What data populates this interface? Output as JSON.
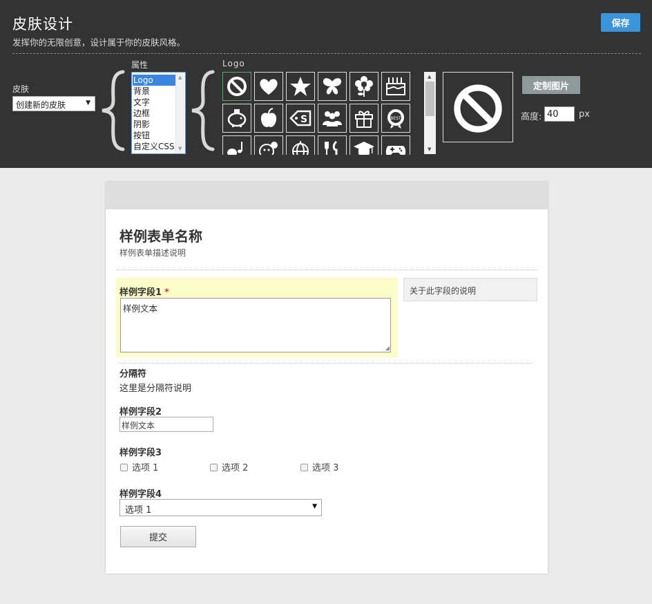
{
  "designer": {
    "title": "皮肤设计",
    "subtitle": "发挥你的无限创意，设计属于你的皮肤风格。",
    "save_label": "保存",
    "skin": {
      "label": "皮肤",
      "selected": "创建新的皮肤"
    },
    "properties": {
      "label": "属性",
      "items": [
        "Logo",
        "背景",
        "文字",
        "边框",
        "阴影",
        "按钮",
        "自定义CSS"
      ],
      "selected": "Logo"
    },
    "logo": {
      "label": "Logo",
      "icons": [
        "ban-icon",
        "heart-icon",
        "star-icon",
        "butterfly-icon",
        "flower-icon",
        "cake-icon",
        "piggy-bank-icon",
        "apple-icon",
        "price-tag-icon",
        "group-icon",
        "gift-icon",
        "best-badge-icon",
        "music-note-icon",
        "chat-face-icon",
        "globe-icon",
        "utensils-icon",
        "graduation-cap-icon",
        "gamepad-icon"
      ],
      "selected_icon": "ban-icon"
    },
    "custom_image_label": "定制图片",
    "height": {
      "label": "高度:",
      "value": "40",
      "unit": "px"
    }
  },
  "form": {
    "title": "样例表单名称",
    "description": "样例表单描述说明",
    "field1": {
      "label": "样例字段1",
      "required_mark": "*",
      "value": "样例文本",
      "help": "关于此字段的说明"
    },
    "separator": {
      "title": "分隔符",
      "description": "这里是分隔符说明"
    },
    "field2": {
      "label": "样例字段2",
      "value": "样例文本"
    },
    "field3": {
      "label": "样例字段3",
      "options": [
        "选项 1",
        "选项 2",
        "选项 3"
      ]
    },
    "field4": {
      "label": "样例字段4",
      "selected": "选项 1"
    },
    "submit_label": "提交"
  },
  "colors": {
    "panel_bg": "#333333",
    "save_button": "#3b93d8",
    "custom_button": "#8e9a9a",
    "highlight_field": "#fcfcc8",
    "required": "#dd3333"
  }
}
